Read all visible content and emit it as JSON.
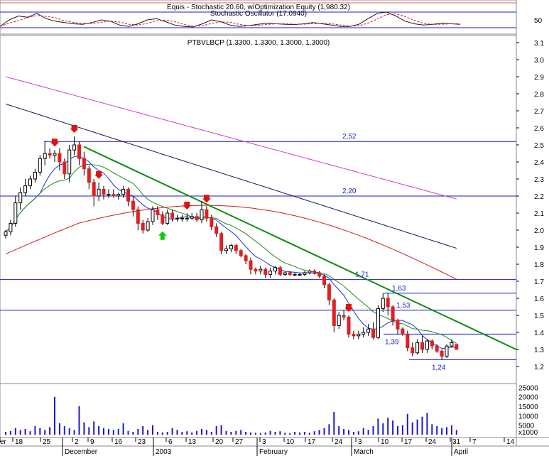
{
  "colors": {
    "background": "#ffffff",
    "up_candle": "#ffffff",
    "down_candle": "#e02020",
    "candle_outline": "#000000",
    "ma_short": "#1f2fd0",
    "ma_mid": "#1a8a1a",
    "ma_long_red": "#d41818",
    "ma_dark": "#151560",
    "ma_magenta": "#d23ad2",
    "trendline": "#0d8a0d",
    "level_lines": "#1a1acc",
    "volume": "#1a1acc",
    "arrow_down": "#e01010",
    "arrow_up": "#10cc10"
  },
  "top_panel": {
    "title": "Equis - Stochastic 20.60, w/Optimization Equity (1,980.32)",
    "subtitle": "Stochastic Oscillator (17.0940)",
    "axis_ticks": [
      "50"
    ]
  },
  "main_panel": {
    "title": "PTBVLBCP (1.3300, 1.3300, 1.3000, 1.3000)"
  },
  "chart_data": {
    "type": "candlestick",
    "symbol": "PTBVLBCP",
    "ylim": [
      1.15,
      3.12
    ],
    "y_ticks": [
      "3.1",
      "3.0",
      "2.9",
      "2.8",
      "2.7",
      "2.6",
      "2.5",
      "2.4",
      "2.3",
      "2.2",
      "2.1",
      "2.0",
      "1.9",
      "1.8",
      "1.7",
      "1.6",
      "1.5",
      "1.4",
      "1.3",
      "1.2"
    ],
    "x_ticks": [
      "er",
      "18",
      "25",
      "December",
      "2",
      "9",
      "16",
      "23",
      "2003",
      "6",
      "13",
      "20",
      "27",
      "February",
      "3",
      "10",
      "17",
      "24",
      "March",
      "3",
      "10",
      "17",
      "24",
      "31",
      "April",
      "7",
      "14"
    ],
    "levels": [
      {
        "value": 2.52,
        "label": "2,52"
      },
      {
        "value": 2.2,
        "label": "2,20"
      },
      {
        "value": 1.71,
        "label": "1,71"
      },
      {
        "value": 1.63,
        "label": "1,63"
      },
      {
        "value": 1.53,
        "label": "1,53"
      },
      {
        "value": 1.39,
        "label": "1,39"
      },
      {
        "value": 1.24,
        "label": "1,24"
      }
    ],
    "candles": [
      {
        "o": 1.97,
        "h": 2.0,
        "l": 1.95,
        "c": 1.99
      },
      {
        "o": 1.99,
        "h": 2.06,
        "l": 1.97,
        "c": 2.04
      },
      {
        "o": 2.04,
        "h": 2.2,
        "l": 2.02,
        "c": 2.16
      },
      {
        "o": 2.16,
        "h": 2.25,
        "l": 2.12,
        "c": 2.22
      },
      {
        "o": 2.22,
        "h": 2.3,
        "l": 2.2,
        "c": 2.26
      },
      {
        "o": 2.26,
        "h": 2.32,
        "l": 2.24,
        "c": 2.3
      },
      {
        "o": 2.3,
        "h": 2.36,
        "l": 2.28,
        "c": 2.34
      },
      {
        "o": 2.34,
        "h": 2.44,
        "l": 2.32,
        "c": 2.42
      },
      {
        "o": 2.42,
        "h": 2.52,
        "l": 2.38,
        "c": 2.45
      },
      {
        "o": 2.45,
        "h": 2.48,
        "l": 2.42,
        "c": 2.44
      },
      {
        "o": 2.44,
        "h": 2.47,
        "l": 2.4,
        "c": 2.45
      },
      {
        "o": 2.45,
        "h": 2.48,
        "l": 2.35,
        "c": 2.4
      },
      {
        "o": 2.4,
        "h": 2.42,
        "l": 2.3,
        "c": 2.33
      },
      {
        "o": 2.33,
        "h": 2.5,
        "l": 2.28,
        "c": 2.47
      },
      {
        "o": 2.47,
        "h": 2.55,
        "l": 2.44,
        "c": 2.5
      },
      {
        "o": 2.5,
        "h": 2.52,
        "l": 2.38,
        "c": 2.42
      },
      {
        "o": 2.42,
        "h": 2.46,
        "l": 2.32,
        "c": 2.36
      },
      {
        "o": 2.36,
        "h": 2.38,
        "l": 2.24,
        "c": 2.28
      },
      {
        "o": 2.28,
        "h": 2.3,
        "l": 2.14,
        "c": 2.2
      },
      {
        "o": 2.2,
        "h": 2.28,
        "l": 2.17,
        "c": 2.24
      },
      {
        "o": 2.24,
        "h": 2.26,
        "l": 2.18,
        "c": 2.21
      },
      {
        "o": 2.21,
        "h": 2.24,
        "l": 2.19,
        "c": 2.21
      },
      {
        "o": 2.21,
        "h": 2.24,
        "l": 2.19,
        "c": 2.2
      },
      {
        "o": 2.2,
        "h": 2.22,
        "l": 2.18,
        "c": 2.21
      },
      {
        "o": 2.21,
        "h": 2.26,
        "l": 2.19,
        "c": 2.24
      },
      {
        "o": 2.24,
        "h": 2.25,
        "l": 2.14,
        "c": 2.17
      },
      {
        "o": 2.17,
        "h": 2.2,
        "l": 2.08,
        "c": 2.12
      },
      {
        "o": 2.12,
        "h": 2.14,
        "l": 2.0,
        "c": 2.04
      },
      {
        "o": 2.04,
        "h": 2.06,
        "l": 1.98,
        "c": 2.0
      },
      {
        "o": 2.0,
        "h": 2.07,
        "l": 1.99,
        "c": 2.05
      },
      {
        "o": 2.05,
        "h": 2.14,
        "l": 2.03,
        "c": 2.12
      },
      {
        "o": 2.12,
        "h": 2.14,
        "l": 2.06,
        "c": 2.09
      },
      {
        "o": 2.09,
        "h": 2.11,
        "l": 2.03,
        "c": 2.04
      },
      {
        "o": 2.04,
        "h": 2.12,
        "l": 2.03,
        "c": 2.1
      },
      {
        "o": 2.1,
        "h": 2.12,
        "l": 2.05,
        "c": 2.07
      },
      {
        "o": 2.07,
        "h": 2.09,
        "l": 2.05,
        "c": 2.07
      },
      {
        "o": 2.07,
        "h": 2.09,
        "l": 2.05,
        "c": 2.07
      },
      {
        "o": 2.07,
        "h": 2.1,
        "l": 2.05,
        "c": 2.07
      },
      {
        "o": 2.07,
        "h": 2.1,
        "l": 2.06,
        "c": 2.08
      },
      {
        "o": 2.08,
        "h": 2.1,
        "l": 2.05,
        "c": 2.06
      },
      {
        "o": 2.06,
        "h": 2.17,
        "l": 2.04,
        "c": 2.12
      },
      {
        "o": 2.12,
        "h": 2.14,
        "l": 2.05,
        "c": 2.07
      },
      {
        "o": 2.07,
        "h": 2.09,
        "l": 2.0,
        "c": 2.02
      },
      {
        "o": 2.02,
        "h": 2.04,
        "l": 1.96,
        "c": 1.98
      },
      {
        "o": 1.98,
        "h": 1.99,
        "l": 1.86,
        "c": 1.88
      },
      {
        "o": 1.88,
        "h": 1.91,
        "l": 1.86,
        "c": 1.89
      },
      {
        "o": 1.89,
        "h": 1.92,
        "l": 1.87,
        "c": 1.91
      },
      {
        "o": 1.91,
        "h": 1.92,
        "l": 1.86,
        "c": 1.88
      },
      {
        "o": 1.88,
        "h": 1.89,
        "l": 1.84,
        "c": 1.85
      },
      {
        "o": 1.85,
        "h": 1.86,
        "l": 1.8,
        "c": 1.82
      },
      {
        "o": 1.82,
        "h": 1.84,
        "l": 1.74,
        "c": 1.77
      },
      {
        "o": 1.77,
        "h": 1.78,
        "l": 1.74,
        "c": 1.76
      },
      {
        "o": 1.76,
        "h": 1.79,
        "l": 1.74,
        "c": 1.77
      },
      {
        "o": 1.77,
        "h": 1.78,
        "l": 1.72,
        "c": 1.74
      },
      {
        "o": 1.74,
        "h": 1.78,
        "l": 1.72,
        "c": 1.76
      },
      {
        "o": 1.76,
        "h": 1.79,
        "l": 1.74,
        "c": 1.78
      },
      {
        "o": 1.78,
        "h": 1.79,
        "l": 1.73,
        "c": 1.74
      },
      {
        "o": 1.74,
        "h": 1.76,
        "l": 1.73,
        "c": 1.75
      },
      {
        "o": 1.75,
        "h": 1.76,
        "l": 1.73,
        "c": 1.74
      },
      {
        "o": 1.74,
        "h": 1.75,
        "l": 1.73,
        "c": 1.74
      },
      {
        "o": 1.74,
        "h": 1.75,
        "l": 1.73,
        "c": 1.74
      },
      {
        "o": 1.74,
        "h": 1.76,
        "l": 1.73,
        "c": 1.75
      },
      {
        "o": 1.75,
        "h": 1.77,
        "l": 1.74,
        "c": 1.76
      },
      {
        "o": 1.76,
        "h": 1.77,
        "l": 1.74,
        "c": 1.75
      },
      {
        "o": 1.75,
        "h": 1.76,
        "l": 1.72,
        "c": 1.73
      },
      {
        "o": 1.73,
        "h": 1.74,
        "l": 1.66,
        "c": 1.68
      },
      {
        "o": 1.68,
        "h": 1.69,
        "l": 1.56,
        "c": 1.59
      },
      {
        "o": 1.59,
        "h": 1.6,
        "l": 1.4,
        "c": 1.44
      },
      {
        "o": 1.44,
        "h": 1.52,
        "l": 1.42,
        "c": 1.5
      },
      {
        "o": 1.5,
        "h": 1.53,
        "l": 1.47,
        "c": 1.49
      },
      {
        "o": 1.49,
        "h": 1.5,
        "l": 1.37,
        "c": 1.39
      },
      {
        "o": 1.39,
        "h": 1.41,
        "l": 1.36,
        "c": 1.38
      },
      {
        "o": 1.38,
        "h": 1.41,
        "l": 1.36,
        "c": 1.39
      },
      {
        "o": 1.39,
        "h": 1.43,
        "l": 1.37,
        "c": 1.4
      },
      {
        "o": 1.4,
        "h": 1.45,
        "l": 1.38,
        "c": 1.42
      },
      {
        "o": 1.42,
        "h": 1.46,
        "l": 1.36,
        "c": 1.37
      },
      {
        "o": 1.37,
        "h": 1.56,
        "l": 1.36,
        "c": 1.54
      },
      {
        "o": 1.54,
        "h": 1.63,
        "l": 1.52,
        "c": 1.6
      },
      {
        "o": 1.6,
        "h": 1.63,
        "l": 1.5,
        "c": 1.55
      },
      {
        "o": 1.55,
        "h": 1.56,
        "l": 1.44,
        "c": 1.47
      },
      {
        "o": 1.47,
        "h": 1.48,
        "l": 1.39,
        "c": 1.42
      },
      {
        "o": 1.42,
        "h": 1.43,
        "l": 1.38,
        "c": 1.39
      },
      {
        "o": 1.39,
        "h": 1.41,
        "l": 1.29,
        "c": 1.31
      },
      {
        "o": 1.31,
        "h": 1.34,
        "l": 1.26,
        "c": 1.28
      },
      {
        "o": 1.28,
        "h": 1.36,
        "l": 1.27,
        "c": 1.34
      },
      {
        "o": 1.34,
        "h": 1.38,
        "l": 1.28,
        "c": 1.3
      },
      {
        "o": 1.3,
        "h": 1.36,
        "l": 1.28,
        "c": 1.35
      },
      {
        "o": 1.35,
        "h": 1.36,
        "l": 1.3,
        "c": 1.32
      },
      {
        "o": 1.32,
        "h": 1.33,
        "l": 1.28,
        "c": 1.29
      },
      {
        "o": 1.29,
        "h": 1.3,
        "l": 1.24,
        "c": 1.26
      },
      {
        "o": 1.26,
        "h": 1.33,
        "l": 1.25,
        "c": 1.32
      },
      {
        "o": 1.32,
        "h": 1.36,
        "l": 1.31,
        "c": 1.34
      },
      {
        "o": 1.33,
        "h": 1.33,
        "l": 1.3,
        "c": 1.3
      }
    ],
    "volume_ticks": [
      "25000",
      "20000",
      "15000",
      "10000",
      "5000",
      "x1000"
    ],
    "volume": [
      1500,
      2000,
      3500,
      2500,
      3000,
      1800,
      4500,
      3500,
      2500,
      4000,
      20000,
      6000,
      4500,
      3500,
      2500,
      15000,
      6500,
      4000,
      7000,
      4500,
      3500,
      3000,
      2500,
      3000,
      6000,
      2000,
      1500,
      3000,
      4500,
      2500,
      5000,
      1500,
      1200,
      1500,
      3500,
      2500,
      1500,
      1800,
      1200,
      2000,
      3000,
      2500,
      1500,
      4500,
      5000,
      2000,
      1500,
      2000,
      2500,
      1500,
      1200,
      1000,
      900,
      1200,
      2000,
      1500,
      1800,
      1000,
      800,
      1500,
      1200,
      1500,
      1000,
      1800,
      2500,
      3500,
      5500,
      12000,
      4500,
      3000,
      2500,
      1500,
      1800,
      3500,
      2500,
      4500,
      8500,
      6000,
      9000,
      7500,
      4500,
      5000,
      11000,
      6500,
      8000,
      9500,
      11500,
      5500,
      4500,
      3500,
      4000,
      5000,
      2500
    ],
    "stochastic_k": [
      30,
      55,
      70,
      65,
      80,
      60,
      50,
      45,
      40,
      38,
      45,
      55,
      50,
      35,
      30,
      40,
      55,
      60,
      48,
      35,
      30,
      28,
      40,
      55,
      48,
      35,
      30,
      33,
      38,
      42,
      40,
      38,
      37,
      40,
      45,
      40,
      35,
      30,
      30,
      38,
      60,
      80,
      85,
      70,
      50,
      40,
      35,
      38,
      42,
      40,
      38
    ]
  },
  "annotations": {
    "down_arrows": [
      10,
      14,
      19,
      37,
      41,
      70
    ],
    "up_arrows": [
      32
    ]
  }
}
